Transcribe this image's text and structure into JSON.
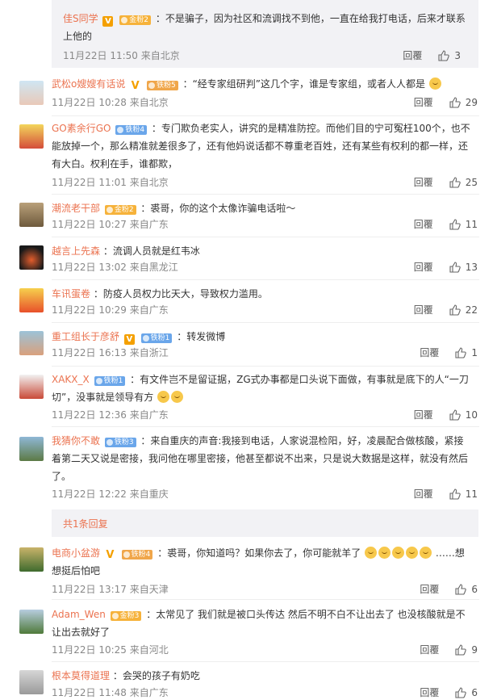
{
  "reply_top": {
    "name": "佳S同学",
    "text": "：不是骗子，因为社区和流调找不到他，一直在给我打电话，后来才联系上他的",
    "time": "11月22日 11:50 来自北京",
    "reply": "回覆",
    "likes": "3",
    "badge": "金粉2"
  },
  "comments": [
    {
      "name": "武松o嫂嫂有话说",
      "badge": "铁粉5",
      "text": "：“经专家组研判”这几个字，谁是专家组，或者人人都是",
      "time": "11月22日 10:28 来自北京",
      "reply": "回覆",
      "likes": "29"
    },
    {
      "name": "GO素余行GO",
      "badge": "铁粉4",
      "text": "：专门欺负老实人，讲究的是精准防控。而他们目的宁可冤枉100个，也不能放掉一个，那么精准就差很多了，还有他妈说话都不尊重老百姓，还有某些有权利的都一样，还有大白。权利在手，谁都欺，",
      "time": "11月22日 11:01 来自北京",
      "reply": "回覆",
      "likes": "25"
    },
    {
      "name": "潮流老干部",
      "badge": "金粉2",
      "text": "：裘哥，你的这个太像诈骗电话啦～",
      "time": "11月22日 10:27 来自广东",
      "reply": "回覆",
      "likes": "11"
    },
    {
      "name": "越言上先森",
      "text": "：流调人员就是红韦冰",
      "time": "11月22日 13:02 来自黑龙江",
      "reply": "回覆",
      "likes": "13"
    },
    {
      "name": "车讯蛋卷",
      "text": "：防疫人员权力比天大，导致权力滥用。",
      "time": "11月22日 10:29 来自广东",
      "reply": "回覆",
      "likes": "22"
    },
    {
      "name": "重工组长于彦舒",
      "badge": "铁粉1",
      "text": "：转发微博",
      "time": "11月22日 16:13 来自浙江",
      "reply": "回覆",
      "likes": "1"
    },
    {
      "name": "XAKX_X",
      "badge": "铁粉1",
      "text": "：有文件岂不是留证据，ZG式办事都是口头说下面做，有事就是底下的人“一刀切”，没事就是领导有方",
      "time": "11月22日 12:36 来自广东",
      "reply": "回覆",
      "likes": "10"
    },
    {
      "name": "我猜你不敢",
      "badge": "铁粉3",
      "text": "：来自重庆的声音:我接到电话，人家说混检阳，好，凌晨配合做核酸，紧接着第二天又说是密接，我问他在哪里密接，他甚至都说不出来，只是说大数据是这样，就没有然后了。",
      "time": "11月22日 12:22 来自重庆",
      "reply": "回覆",
      "likes": "11"
    }
  ],
  "sub_replies_label": "共1条回复",
  "comments2": [
    {
      "name": "电商小盆游",
      "badge": "铁粉4",
      "text": "：裘哥，你知道吗？如果你去了，你可能就羊了",
      "tail": "……想想挺后怕吧",
      "time": "11月22日 13:17 来自天津",
      "reply": "回覆",
      "likes": "6"
    },
    {
      "name": "Adam_Wen",
      "badge": "金粉3",
      "text": "：太常见了 我们就是被口头传达 然后不明不白不让出去了 也没核酸就是不让出去就好了",
      "time": "11月22日 10:25 来自河北",
      "reply": "回覆",
      "likes": "9"
    },
    {
      "name": "根本莫得道理",
      "text": "：会哭的孩子有奶吃",
      "time": "11月22日 11:48 来自广东",
      "reply": "回覆",
      "likes": "6"
    }
  ],
  "colors": {
    "accent": "#eb7350",
    "meta": "#888888",
    "panel": "#f2f2f5"
  }
}
